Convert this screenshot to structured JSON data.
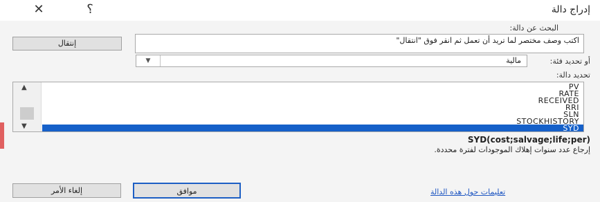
{
  "window": {
    "title": "إدراج دالة",
    "help_glyph": "؟",
    "close_glyph": "✕"
  },
  "search": {
    "label": "البحث عن دالة:",
    "value": "اكتب وصف مختصر لما تريد أن تعمل ثم انقر فوق \"انتقال\"",
    "go_label": "إنتقال"
  },
  "category": {
    "label": "أو تحديد فئة:",
    "value": "مالية"
  },
  "functions": {
    "label": "تحديد دالة:",
    "items": [
      "PV",
      "RATE",
      "RECEIVED",
      "RRI",
      "SLN",
      "STOCKHISTORY",
      "SYD"
    ],
    "selected": "SYD"
  },
  "syntax": "SYD(cost;salvage;life;per)",
  "description": "إرجاع عدد سنوات إهلاك الموجودات لفترة محددة.",
  "help_link": "تعليمات حول هذه الدالة",
  "buttons": {
    "ok": "موافق",
    "cancel": "إلغاء الأمر"
  }
}
